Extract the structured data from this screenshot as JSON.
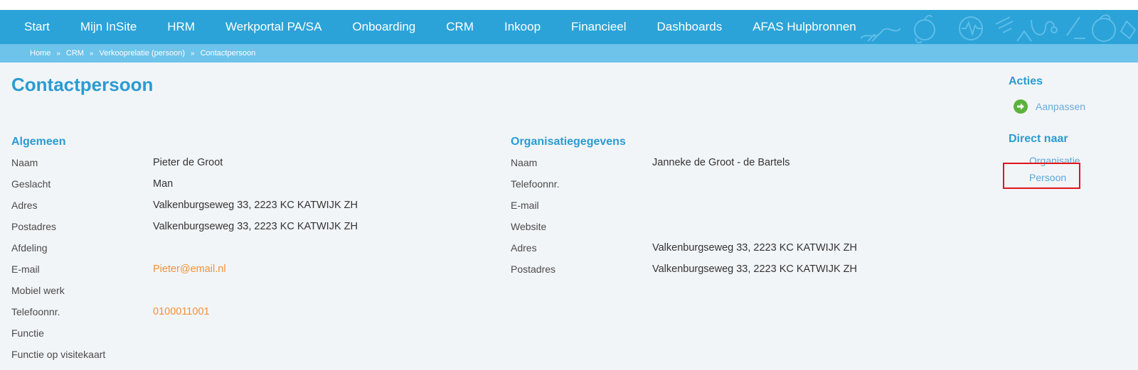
{
  "nav": {
    "items": [
      "Start",
      "Mijn InSite",
      "HRM",
      "Werkportal PA/SA",
      "Onboarding",
      "CRM",
      "Inkoop",
      "Financieel",
      "Dashboards",
      "AFAS Hulpbronnen"
    ]
  },
  "breadcrumb": {
    "items": [
      "Home",
      "CRM",
      "Verkooprelatie (persoon)",
      "Contactpersoon"
    ],
    "separator": "»"
  },
  "page": {
    "title": "Contactpersoon"
  },
  "algemeen": {
    "title": "Algemeen",
    "rows": [
      {
        "label": "Naam",
        "value": "Pieter de Groot"
      },
      {
        "label": "Geslacht",
        "value": "Man"
      },
      {
        "label": "Adres",
        "value": "Valkenburgseweg 33, 2223 KC KATWIJK ZH"
      },
      {
        "label": "Postadres",
        "value": "Valkenburgseweg 33, 2223 KC KATWIJK ZH"
      },
      {
        "label": "Afdeling",
        "value": ""
      },
      {
        "label": "E-mail",
        "value": "Pieter@email.nl"
      },
      {
        "label": "Mobiel werk",
        "value": ""
      },
      {
        "label": "Telefoonnr.",
        "value": "0100011001"
      },
      {
        "label": "Functie",
        "value": ""
      },
      {
        "label": "Functie op visitekaart",
        "value": ""
      }
    ]
  },
  "organisatie": {
    "title": "Organisatiegegevens",
    "rows": [
      {
        "label": "Naam",
        "value": "Janneke de Groot - de Bartels"
      },
      {
        "label": "Telefoonnr.",
        "value": ""
      },
      {
        "label": "E-mail",
        "value": ""
      },
      {
        "label": "Website",
        "value": ""
      },
      {
        "label": "Adres",
        "value": "Valkenburgseweg 33, 2223 KC KATWIJK ZH"
      },
      {
        "label": "Postadres",
        "value": "Valkenburgseweg 33, 2223 KC KATWIJK ZH"
      }
    ]
  },
  "sidebar": {
    "acties_title": "Acties",
    "aanpassen_label": "Aanpassen",
    "direct_title": "Direct naar",
    "organisatie_label": "Organisatie",
    "persoon_label": "Persoon"
  },
  "colors": {
    "nav_bg": "#2ba3d8",
    "crumb_bg": "#6dc3ea",
    "heading": "#2a9bd2",
    "link_orange": "#f29137",
    "action_green": "#5cb33a",
    "highlight_red": "#e0141b"
  }
}
